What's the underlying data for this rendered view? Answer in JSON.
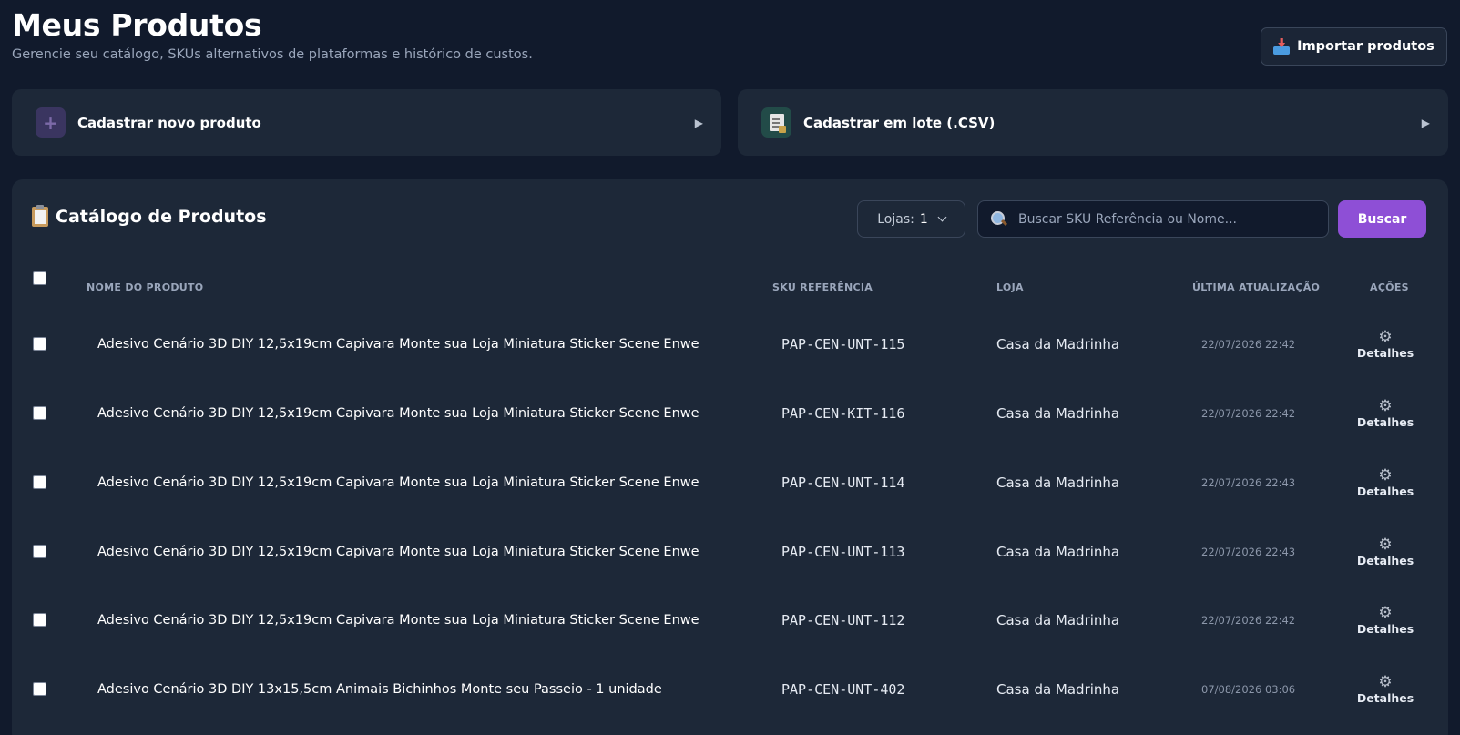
{
  "header": {
    "title": "Meus Produtos",
    "subtitle": "Gerencie seu catálogo, SKUs alternativos de plataformas e histórico de custos.",
    "import_button": "Importar produtos"
  },
  "cards": {
    "new_product": "Cadastrar novo produto",
    "batch_csv": "Cadastrar em lote (.CSV)"
  },
  "catalog": {
    "title": "Catálogo de Produtos",
    "store_filter_label": "Lojas:",
    "store_filter_value": "1",
    "search_placeholder": "Buscar SKU Referência ou Nome...",
    "search_value": "",
    "search_button": "Buscar",
    "columns": {
      "name": "NOME DO PRODUTO",
      "sku": "SKU REFERÊNCIA",
      "store": "LOJA",
      "updated": "ÚLTIMA ATUALIZAÇÃO",
      "actions": "AÇÕES"
    },
    "rows": [
      {
        "name": "Adesivo Cenário 3D DIY 12,5x19cm Capivara Monte sua Loja Miniatura Sticker Scene Enwe",
        "sku": "PAP-CEN-UNT-115",
        "store": "Casa da Madrinha",
        "updated": "22/07/2026 22:42",
        "action": "Detalhes"
      },
      {
        "name": "Adesivo Cenário 3D DIY 12,5x19cm Capivara Monte sua Loja Miniatura Sticker Scene Enwe",
        "sku": "PAP-CEN-KIT-116",
        "store": "Casa da Madrinha",
        "updated": "22/07/2026 22:42",
        "action": "Detalhes"
      },
      {
        "name": "Adesivo Cenário 3D DIY 12,5x19cm Capivara Monte sua Loja Miniatura Sticker Scene Enwe",
        "sku": "PAP-CEN-UNT-114",
        "store": "Casa da Madrinha",
        "updated": "22/07/2026 22:43",
        "action": "Detalhes"
      },
      {
        "name": "Adesivo Cenário 3D DIY 12,5x19cm Capivara Monte sua Loja Miniatura Sticker Scene Enwe",
        "sku": "PAP-CEN-UNT-113",
        "store": "Casa da Madrinha",
        "updated": "22/07/2026 22:43",
        "action": "Detalhes"
      },
      {
        "name": "Adesivo Cenário 3D DIY 12,5x19cm Capivara Monte sua Loja Miniatura Sticker Scene Enwe",
        "sku": "PAP-CEN-UNT-112",
        "store": "Casa da Madrinha",
        "updated": "22/07/2026 22:42",
        "action": "Detalhes"
      },
      {
        "name": "Adesivo Cenário 3D DIY 13x15,5cm Animais Bichinhos Monte seu Passeio - 1 unidade",
        "sku": "PAP-CEN-UNT-402",
        "store": "Casa da Madrinha",
        "updated": "07/08/2026 03:06",
        "action": "Detalhes"
      }
    ]
  },
  "icons": {
    "import": "inbox-tray-icon",
    "new_product": "plus-icon",
    "batch_csv": "document-icon",
    "catalog": "clipboard-icon",
    "search": "search-icon",
    "details": "gear-icon",
    "card_arrow": "play-arrow-icon"
  },
  "colors": {
    "background": "#111a2c",
    "panel": "#1d2838",
    "accent": "#8e4fd6"
  }
}
